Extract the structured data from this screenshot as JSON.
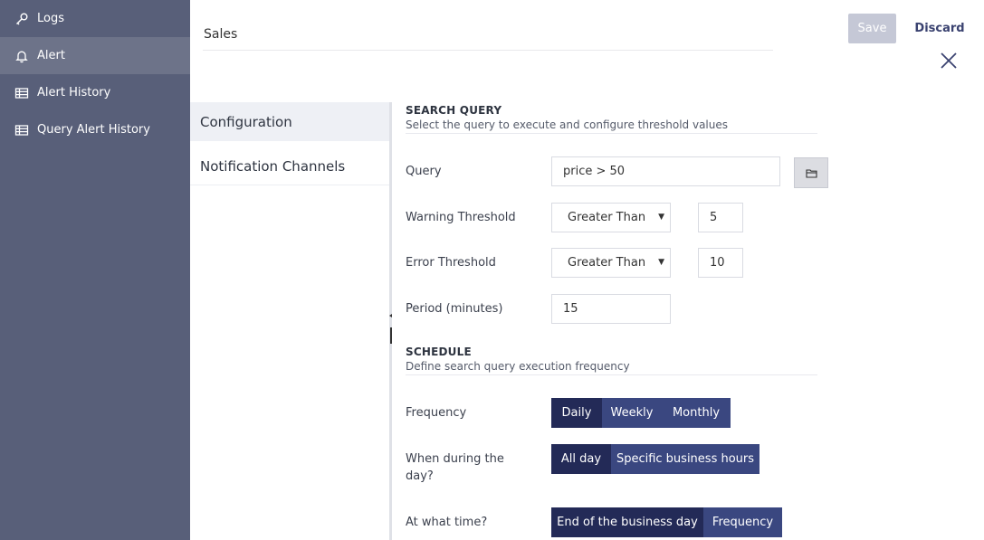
{
  "sidebar": {
    "items": [
      {
        "label": "Logs",
        "icon": "key-icon"
      },
      {
        "label": "Alert",
        "icon": "bell-icon",
        "active": true
      },
      {
        "label": "Alert History",
        "icon": "table-icon"
      },
      {
        "label": "Query Alert History",
        "icon": "table-icon"
      }
    ]
  },
  "header": {
    "name_value": "Sales",
    "save_label": "Save",
    "discard_label": "Discard"
  },
  "tabs": [
    {
      "label": "Configuration",
      "active": true
    },
    {
      "label": "Notification Channels",
      "active": false
    }
  ],
  "search_query": {
    "title": "SEARCH QUERY",
    "subtitle": "Select the query to execute and configure threshold values",
    "query_label": "Query",
    "query_value": "price > 50",
    "warning_label": "Warning Threshold",
    "warning_operator": "Greater Than",
    "warning_value": "5",
    "error_label": "Error Threshold",
    "error_operator": "Greater Than",
    "error_value": "10",
    "period_label": "Period (minutes)",
    "period_value": "15"
  },
  "schedule": {
    "title": "SCHEDULE",
    "subtitle": "Define search query execution frequency",
    "frequency_label": "Frequency",
    "frequency_options": [
      "Daily",
      "Weekly",
      "Monthly"
    ],
    "frequency_selected": "Daily",
    "when_label": "When during the day?",
    "when_options": [
      "All day",
      "Specific business hours"
    ],
    "when_selected": "All day",
    "time_label": "At what time?",
    "time_options": [
      "End of the business day",
      "Frequency"
    ],
    "time_selected": "End of the business day"
  },
  "colors": {
    "sidebar_bg": "#585f79",
    "accent_dark": "#232a57",
    "accent": "#3a4780",
    "save_disabled": "#c5c8d6"
  }
}
